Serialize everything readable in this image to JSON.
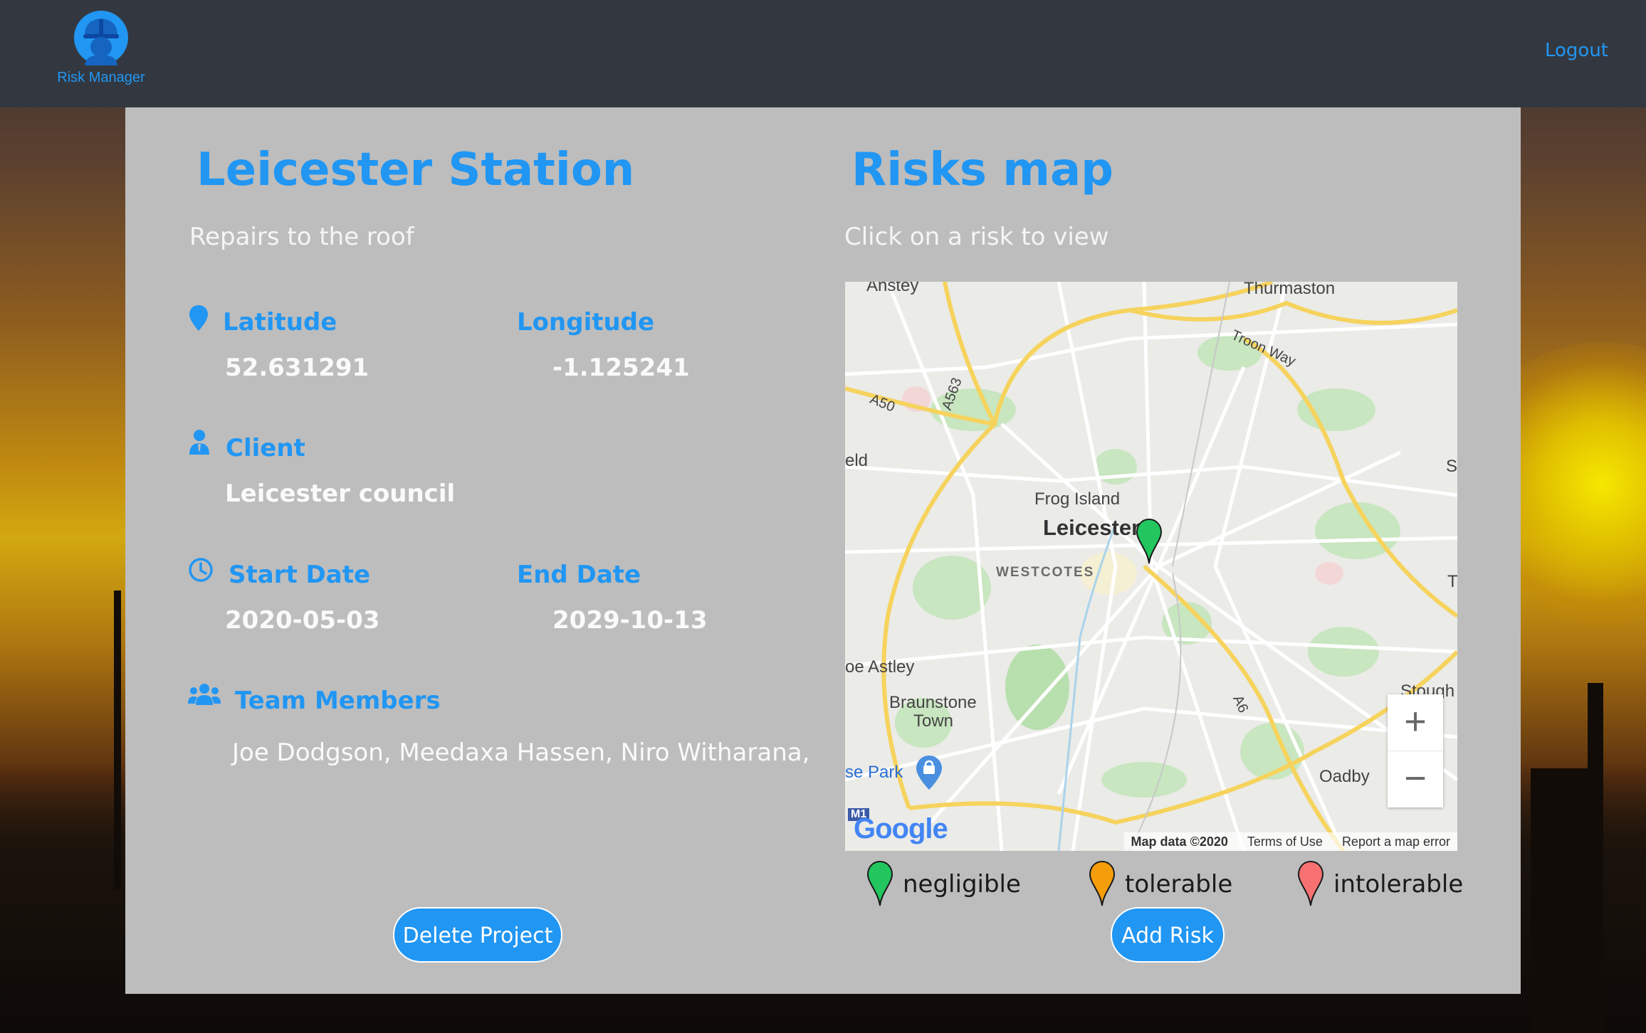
{
  "app": {
    "logo_text": "Risk Manager",
    "logout_label": "Logout"
  },
  "project": {
    "title": "Leicester Station",
    "description": "Repairs to the roof",
    "latitude_label": "Latitude",
    "latitude": "52.631291",
    "longitude_label": "Longitude",
    "longitude": "-1.125241",
    "client_label": "Client",
    "client": "Leicester council",
    "start_label": "Start Date",
    "start_date": "2020-05-03",
    "end_label": "End Date",
    "end_date": "2029-10-13",
    "team_label": "Team Members",
    "team_members": "Joe Dodgson,  Meedaxa Hassen,  Niro Witharana,",
    "delete_label": "Delete Project"
  },
  "risks": {
    "title": "Risks map",
    "subtitle": "Click on a risk to view",
    "add_label": "Add Risk",
    "legend": [
      {
        "label": "negligible",
        "color": "#22c55e"
      },
      {
        "label": "tolerable",
        "color": "#f59e0b"
      },
      {
        "label": "intolerable",
        "color": "#f87171"
      }
    ]
  },
  "map": {
    "places": {
      "anstey": "Anstey",
      "thurmaston": "Thurmaston",
      "troon_way": "Troon Way",
      "a50": "A50",
      "a563": "A563",
      "eld": "eld",
      "s": "S",
      "frog_island": "Frog Island",
      "leicester": "Leicester",
      "westcotes": "WESTCOTES",
      "t": "T",
      "oe_astley": "oe Astley",
      "braunstone": "Braunstone",
      "town": "Town",
      "stough": "Stough",
      "a6": "A6",
      "se_park": "se Park",
      "oadby": "Oadby",
      "m1": "M1"
    },
    "logo": "Google",
    "attribution": {
      "data": "Map data ©2020",
      "terms": "Terms of Use",
      "report": "Report a map error"
    },
    "zoom_in": "+",
    "zoom_out": "−",
    "marker_color": "#22c55e"
  }
}
